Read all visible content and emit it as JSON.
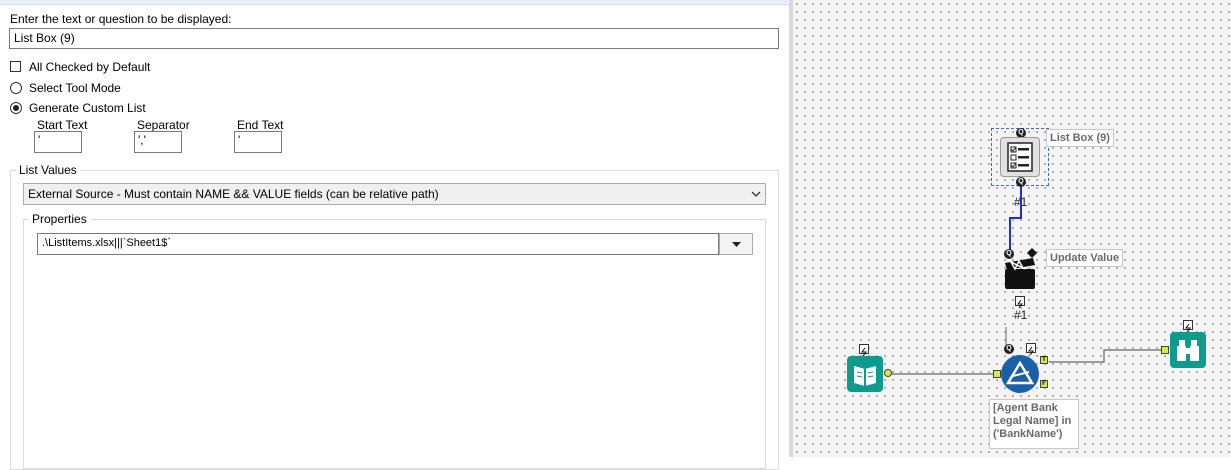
{
  "config": {
    "prompt_label": "Enter the text or question to be displayed:",
    "prompt_value": "List Box (9)",
    "all_checked_label": "All Checked by Default",
    "select_tool_mode_label": "Select Tool Mode",
    "generate_custom_list_label": "Generate Custom List",
    "start_text_label": "Start Text",
    "start_text_value": "'",
    "separator_label": "Separator",
    "separator_value": "','",
    "end_text_label": "End Text",
    "end_text_value": "'",
    "list_values_label": "List Values",
    "list_values_selected": "External Source - Must contain NAME && VALUE fields  (can be relative path)",
    "properties_label": "Properties",
    "properties_value": ".\\ListItems.xlsx|||`Sheet1$`"
  },
  "canvas": {
    "listbox_label": "List Box (9)",
    "connection_1_label": "#1",
    "update_value_label": "Update Value",
    "connection_2_label": "#1",
    "filter_expression_label": "[Agent Bank\nLegal Name] in\n('BankName')",
    "ports": {
      "q": "Q",
      "t": "T",
      "f": "F"
    }
  },
  "colors": {
    "tool_teal": "#0f9a8e",
    "filter_blue": "#1b5fa8",
    "port_yellow": "#d7e84a",
    "selection_dash": "#2e6fd1",
    "question_line": "#1c2ee0"
  },
  "icons": [
    "listbox-icon",
    "action-clapperboard-icon",
    "input-book-icon",
    "filter-triangle-icon",
    "browse-binoculars-icon",
    "lightning-icon",
    "dropdown-arrow-icon"
  ]
}
